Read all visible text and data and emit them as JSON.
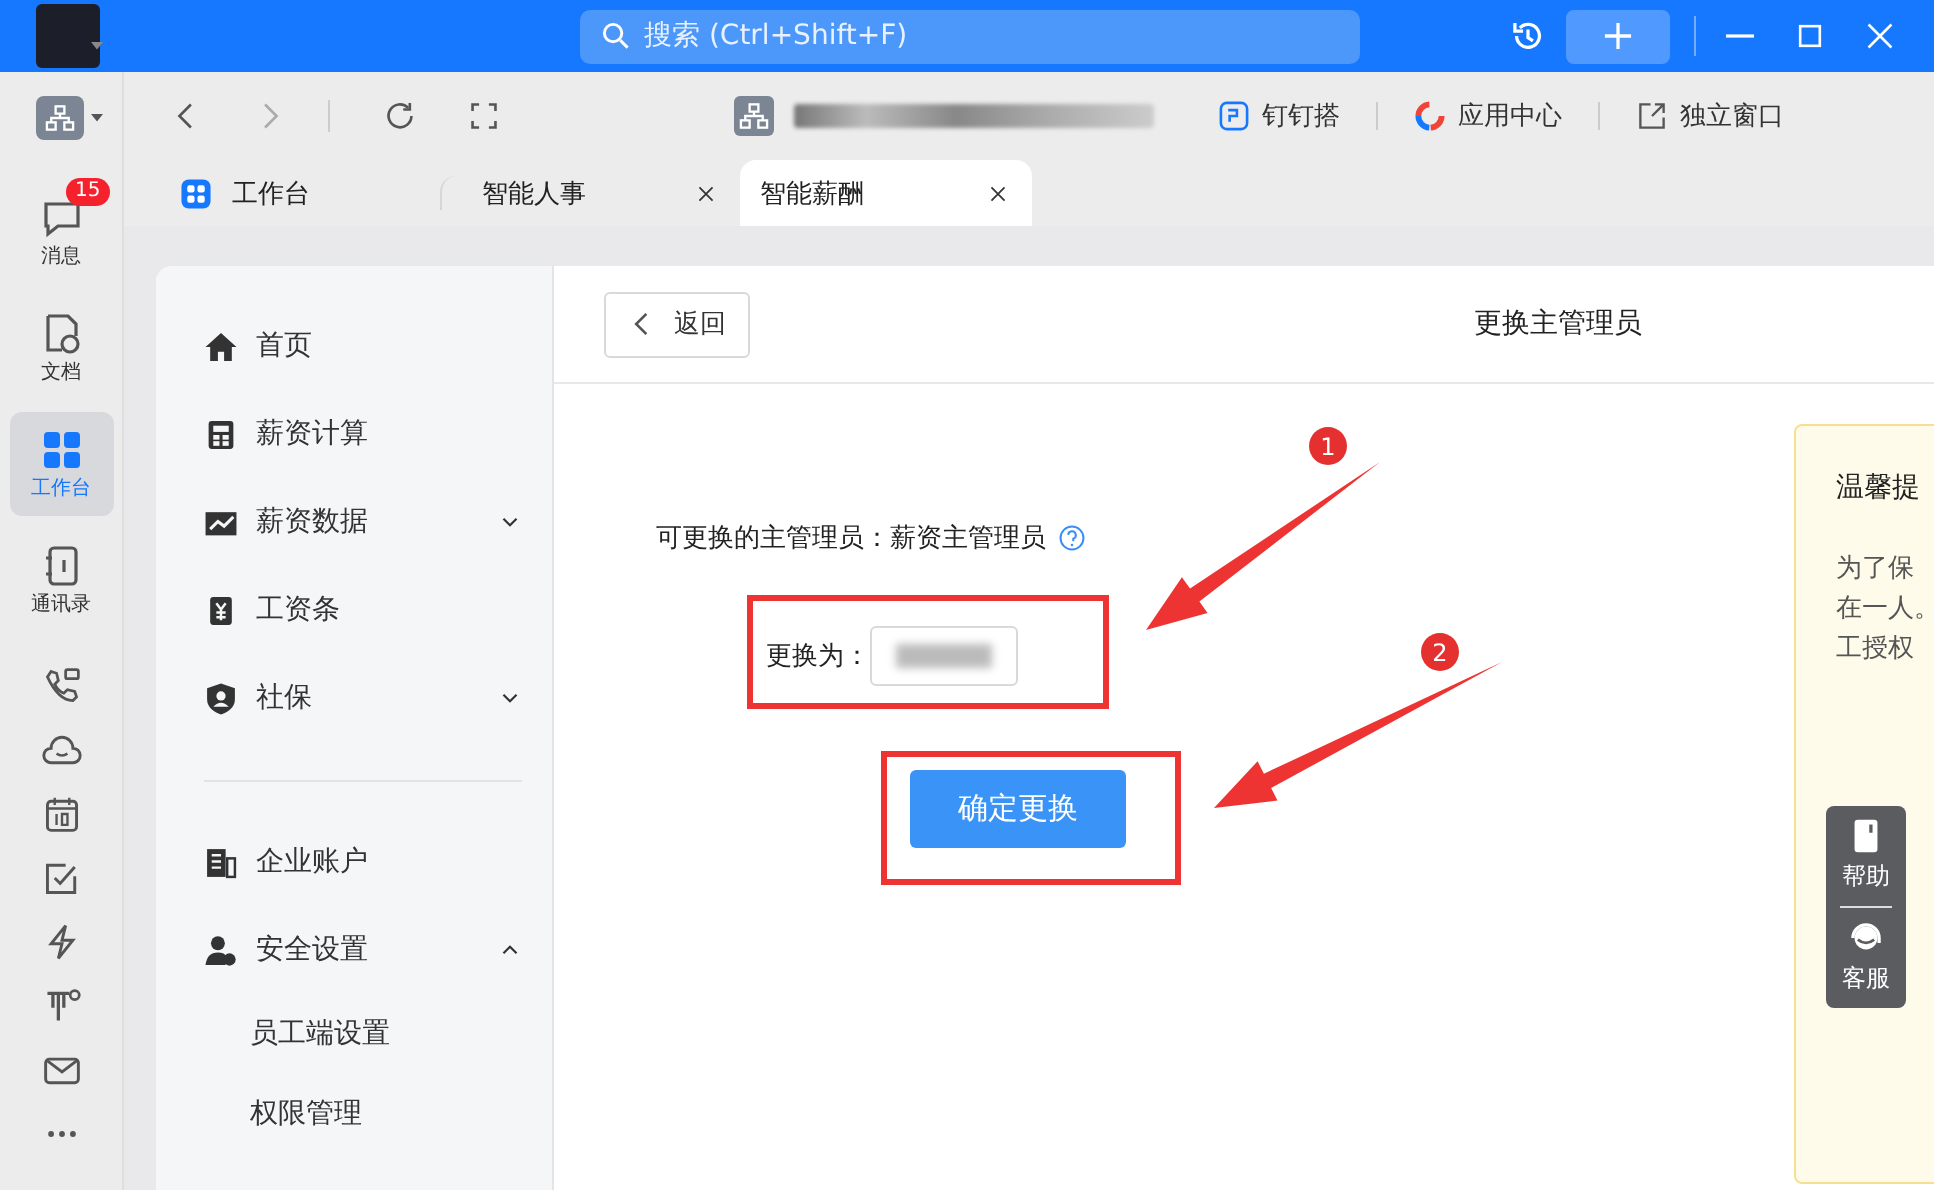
{
  "topbar": {
    "search_placeholder": "搜索 (Ctrl+Shift+F)"
  },
  "rail": {
    "items": [
      {
        "kind": "chat",
        "label": "消息",
        "badge": "15",
        "selected": false
      },
      {
        "kind": "doc",
        "label": "文档",
        "selected": false
      },
      {
        "kind": "grid",
        "label": "工作台",
        "selected": true
      },
      {
        "kind": "contacts",
        "label": "通讯录",
        "selected": false
      }
    ],
    "tools": [
      {
        "kind": "phone"
      },
      {
        "kind": "cloud"
      },
      {
        "kind": "calendar"
      },
      {
        "kind": "check"
      },
      {
        "kind": "bolt"
      },
      {
        "kind": "text"
      },
      {
        "kind": "mail"
      },
      {
        "kind": "more"
      }
    ]
  },
  "toolbar": {
    "links": [
      {
        "kind": "build",
        "label": "钉钉搭"
      },
      {
        "kind": "apps",
        "label": "应用中心"
      },
      {
        "kind": "window",
        "label": "独立窗口"
      }
    ]
  },
  "tabs": [
    {
      "label": "工作台",
      "selected": false,
      "closable": false
    },
    {
      "label": "智能人事",
      "selected": false,
      "closable": true
    },
    {
      "label": "智能薪酬",
      "selected": true,
      "closable": true
    }
  ],
  "nav": {
    "items": [
      {
        "kind": "home",
        "label": "首页"
      },
      {
        "kind": "calc",
        "label": "薪资计算"
      },
      {
        "kind": "chart",
        "label": "薪资数据",
        "expanded": false
      },
      {
        "kind": "slip",
        "label": "工资条"
      },
      {
        "kind": "shield",
        "label": "社保",
        "expanded": false
      },
      {
        "kind": "divider"
      },
      {
        "kind": "bank",
        "label": "企业账户"
      },
      {
        "kind": "user",
        "label": "安全设置",
        "expanded": true,
        "children": [
          {
            "label": "员工端设置"
          },
          {
            "label": "权限管理"
          }
        ]
      }
    ]
  },
  "page": {
    "back": "返回",
    "title": "更换主管理员",
    "current": "可更换的主管理员：薪资主管理员",
    "field_label": "更换为：",
    "confirm": "确定更换",
    "tip": {
      "title": "温馨提",
      "lines": [
        "为了保",
        "在一人。",
        "工授权"
      ]
    },
    "float": [
      {
        "kind": "book",
        "label": "帮助"
      },
      {
        "kind": "service",
        "label": "客服"
      }
    ]
  },
  "annotations": [
    {
      "number": "1"
    },
    {
      "number": "2"
    }
  ]
}
